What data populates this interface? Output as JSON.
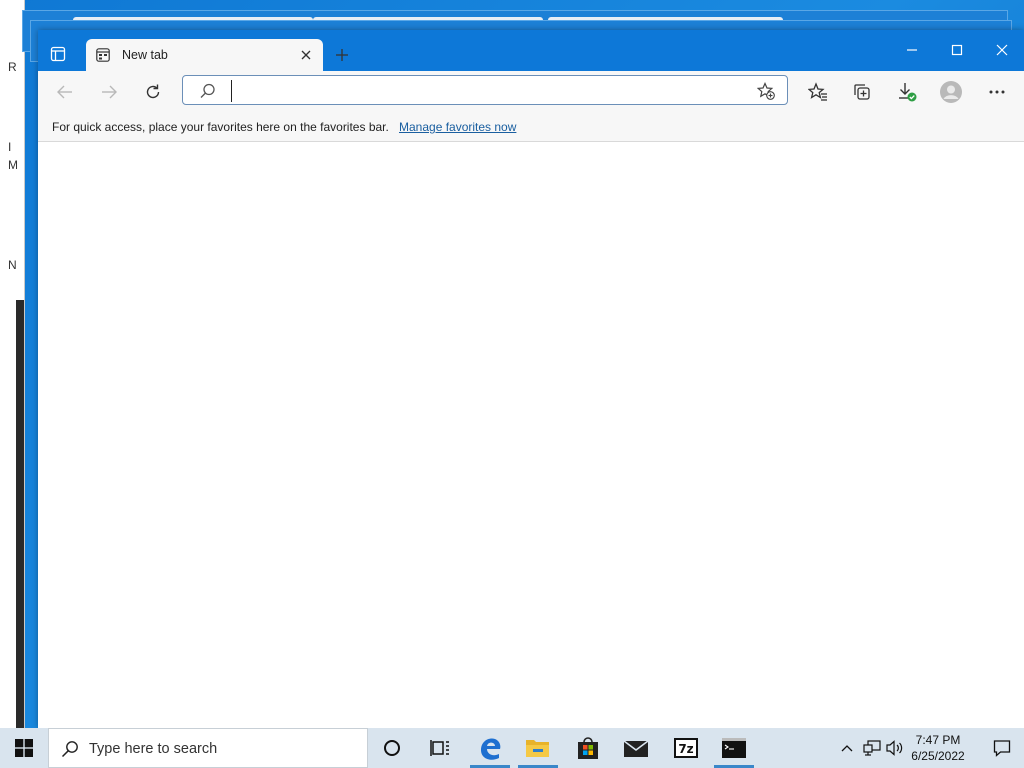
{
  "desktop": {
    "left_window_glyphs": [
      "R",
      "I",
      "M",
      "N"
    ]
  },
  "browser": {
    "tab": {
      "title": "New tab"
    },
    "address_bar": {
      "value": "",
      "placeholder": ""
    },
    "favorites_bar": {
      "message": "For quick access, place your favorites here on the favorites bar.",
      "link": "Manage favorites now"
    }
  },
  "taskbar": {
    "search_placeholder": "Type here to search",
    "apps": [
      "task-view",
      "edge",
      "file-explorer",
      "microsoft-store",
      "mail",
      "7-zip",
      "command-prompt"
    ],
    "clock": {
      "time": "7:47 PM",
      "date": "6/25/2022"
    }
  },
  "colors": {
    "titlebar": "#0d78d8",
    "desktop": "#1a86d8",
    "link": "#1a5fa0",
    "taskbar": "#d9e4ee"
  }
}
